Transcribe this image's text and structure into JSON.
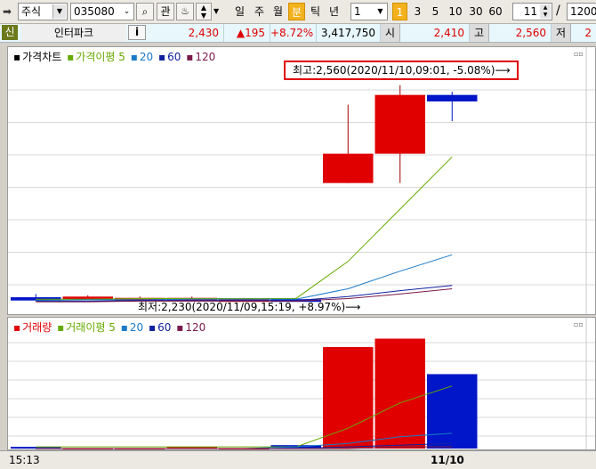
{
  "toolbar": {
    "market_select": "주식",
    "code_value": "035080",
    "search_glyph": "⌕",
    "interest_label": "관",
    "periods": [
      "일",
      "주",
      "월",
      "분",
      "틱",
      "년"
    ],
    "active_period": "분",
    "interval_value": "1",
    "minute_units": [
      "1",
      "3",
      "5",
      "10",
      "30",
      "60"
    ],
    "active_unit": "1",
    "count_value": "11",
    "slash": "/",
    "total_value": "1200"
  },
  "info": {
    "badge": "신",
    "name": "인터파크",
    "info_glyph": "i",
    "price": "2,430",
    "change": "▲195",
    "change_pct": "+8.72%",
    "volume": "3,417,750",
    "open_label": "시",
    "open": "2,410",
    "high_label": "고",
    "high": "2,560",
    "low_label": "저",
    "low": "2"
  },
  "colors": {
    "up": "#e00000",
    "down": "#0016c8",
    "ma5": "#66aa00",
    "ma20": "#1a7ac8",
    "ma60": "#1020a0",
    "ma120": "#7a1a4a"
  },
  "price_chart": {
    "legend": [
      "가격차트",
      "가격이평 5",
      "20",
      "60",
      "120"
    ],
    "high_annotation": "최고:2,560(2020/11/10,09:01, -5.08%)⟶",
    "low_annotation": "최저:2,230(2020/11/09,15:19, +8.97%)⟶"
  },
  "volume_chart": {
    "legend": [
      "거래량",
      "거래이평 5",
      "20",
      "60",
      "120"
    ]
  },
  "time_axis": {
    "left_label": "15:13",
    "date_label": "11/10"
  },
  "chart_data": {
    "type": "candlestick",
    "candles": [
      {
        "open": 2235,
        "high": 2240,
        "low": 2230,
        "close": 2230,
        "volume": 1
      },
      {
        "open": 2236,
        "high": 2238,
        "low": 2232,
        "close": 2236,
        "volume": 0
      },
      {
        "open": 2234,
        "high": 2236,
        "low": 2232,
        "close": 2234,
        "volume": 0
      },
      {
        "open": 2234,
        "high": 2236,
        "low": 2232,
        "close": 2234,
        "volume": 1
      },
      {
        "open": 2232,
        "high": 2234,
        "low": 2230,
        "close": 2232,
        "volume": 0
      },
      {
        "open": 2232,
        "high": 2234,
        "low": 2230,
        "close": 2230,
        "volume": 2
      },
      {
        "open": 2410,
        "high": 2530,
        "low": 2410,
        "close": 2455,
        "volume": 60
      },
      {
        "open": 2455,
        "high": 2560,
        "low": 2410,
        "close": 2545,
        "volume": 65
      },
      {
        "open": 2545,
        "high": 2550,
        "low": 2505,
        "close": 2535,
        "volume": 44
      }
    ],
    "price_ma": {
      "ma5": [
        2232,
        2232,
        2233,
        2233,
        2233,
        2233,
        2290,
        2370,
        2450
      ],
      "ma20": [
        2230,
        2231,
        2231,
        2232,
        2232,
        2232,
        2248,
        2275,
        2300
      ],
      "ma60": [
        2229,
        2229,
        2230,
        2230,
        2230,
        2230,
        2236,
        2245,
        2253
      ],
      "ma120": [
        2228,
        2228,
        2229,
        2229,
        2229,
        2229,
        2233,
        2240,
        2248
      ]
    },
    "volume_ma": {
      "ma5": [
        1,
        1,
        1,
        1,
        1,
        1,
        12,
        27,
        37
      ],
      "ma20": [
        0,
        0,
        0,
        0,
        0,
        1,
        3,
        7,
        9
      ],
      "ma60": [
        0,
        0,
        0,
        0,
        0,
        0,
        1,
        2,
        3
      ],
      "ma120": [
        0,
        0,
        0,
        0,
        0,
        0,
        0,
        1,
        1
      ]
    },
    "price_range": [
      2220,
      2580
    ],
    "volume_range": [
      0,
      70
    ],
    "grid": true
  }
}
